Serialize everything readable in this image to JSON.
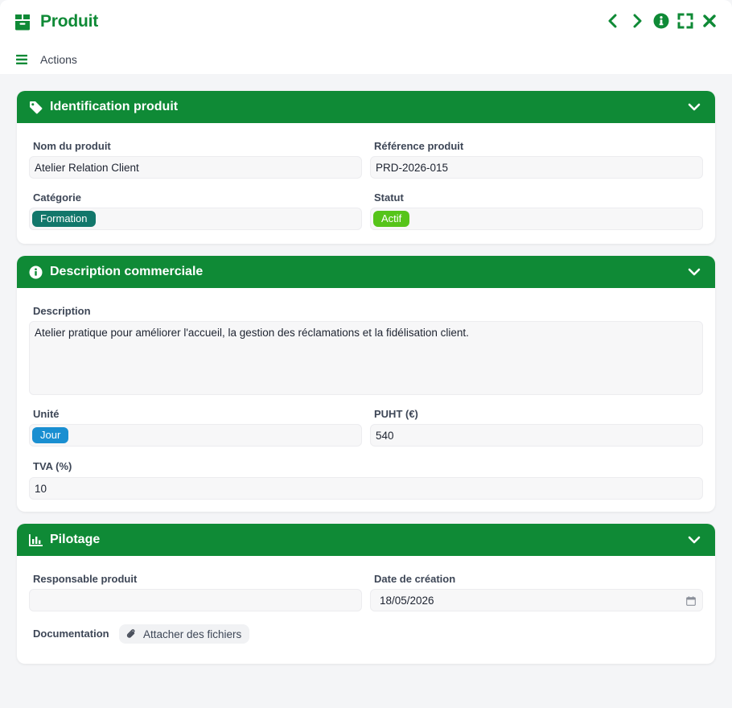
{
  "app": {
    "title": "Produit",
    "icon": "box-icon",
    "accent_color": "#0f8a36",
    "controls": [
      "chevron-left-icon",
      "chevron-right-icon",
      "info-icon",
      "fullscreen-icon",
      "close-icon"
    ]
  },
  "actions": {
    "label": "Actions",
    "icon": "menu-icon"
  },
  "sections": {
    "identification": {
      "title": "Identification produit",
      "icon": "tag-icon",
      "name_label": "Nom du produit",
      "name_value": "Atelier Relation Client",
      "ref_label": "Référence produit",
      "ref_value": "PRD-2026-015",
      "category_label": "Catégorie",
      "category_value": "Formation",
      "category_color": "#12776b",
      "status_label": "Statut",
      "status_value": "Actif",
      "status_color": "#56c41a"
    },
    "commercial": {
      "title": "Description commerciale",
      "icon": "info-circle-icon",
      "description_label": "Description",
      "description_value": "Atelier pratique pour améliorer l'accueil, la gestion des réclamations et la fidélisation client.",
      "unit_label": "Unité",
      "unit_value": "Jour",
      "unit_color": "#1a8fd1",
      "puht_label": "PUHT (€)",
      "puht_value": "540",
      "tva_label": "TVA (%)",
      "tva_value": "10"
    },
    "pilotage": {
      "title": "Pilotage",
      "icon": "bar-chart-icon",
      "owner_label": "Responsable produit",
      "owner_value": "",
      "date_label": "Date de création",
      "date_value": "18/05/2026",
      "doc_label": "Documentation",
      "attach_label": "Attacher des fichiers"
    }
  }
}
